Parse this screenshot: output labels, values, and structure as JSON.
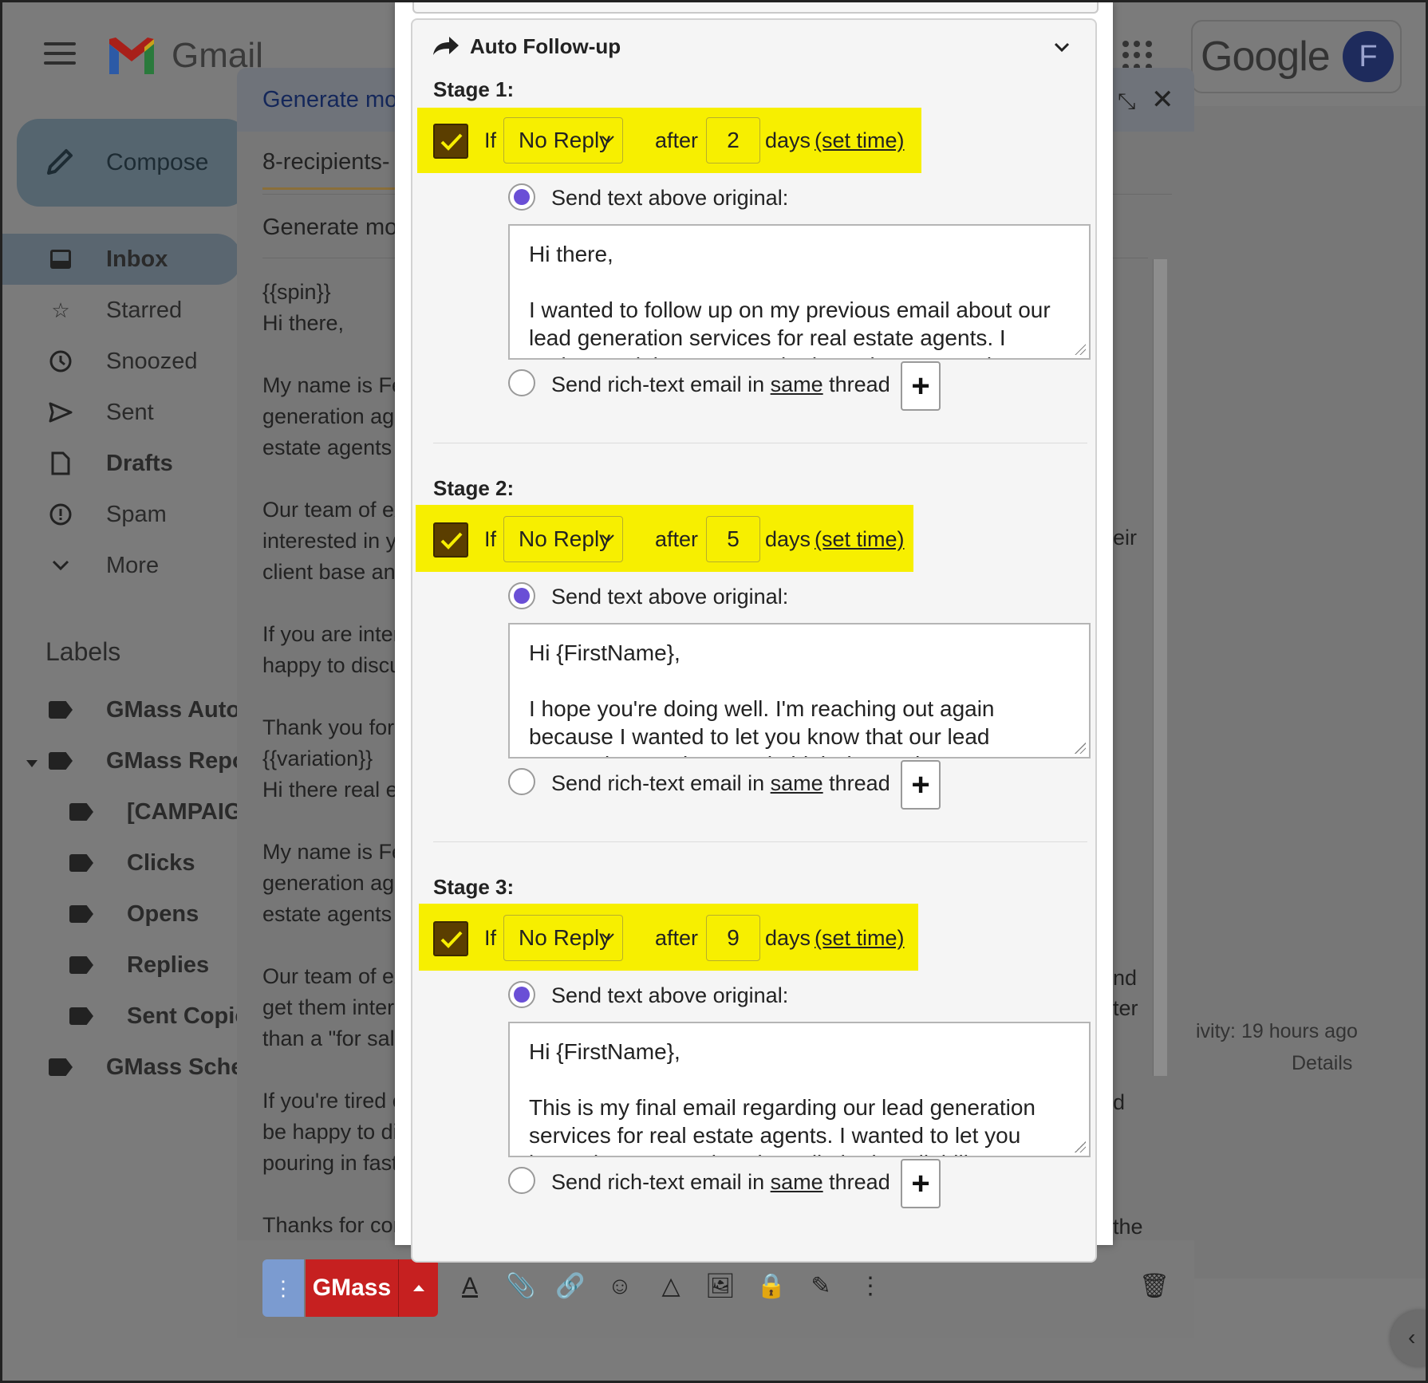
{
  "gmail": {
    "logo_text": "Gmail",
    "google_text": "Google",
    "avatar_letter": "F",
    "compose_label": "Compose",
    "nav": [
      {
        "label": "Inbox",
        "icon": "inbox-icon",
        "bold": true
      },
      {
        "label": "Starred",
        "icon": "star-icon"
      },
      {
        "label": "Snoozed",
        "icon": "clock-icon"
      },
      {
        "label": "Sent",
        "icon": "send-icon"
      },
      {
        "label": "Drafts",
        "icon": "draft-icon",
        "bold": true
      },
      {
        "label": "Spam",
        "icon": "spam-icon"
      },
      {
        "label": "More",
        "icon": "chevron-down-icon"
      }
    ],
    "labels_heading": "Labels",
    "labels": [
      "GMass Auto",
      "GMass Repo",
      "[CAMPAIG",
      "Clicks",
      "Opens",
      "Replies",
      "Sent Copie",
      "GMass Sche"
    ],
    "activity": "ivity: 19 hours ago",
    "details": "Details"
  },
  "compose": {
    "title": "Generate mo",
    "subject": "8-recipients-",
    "from_line": "Generate mo",
    "body_left": "{{spin}}\nHi there,\n\nMy name is Fe\ngeneration age\nestate agents\n\nOur team of ex\ninterested in yo\nclient base and\n\nIf you are inter\nhappy to discu\n\nThank you for\n{{variation}}\nHi there real e\n\nMy name is Fe\ngeneration age\nestate agents\n\nOur team of ex\nget them intere\nthan a \"for sale\n\nIf you're tired c\nbe happy to di\npouring in fast\n\nThanks for cor",
    "body_right": [
      "eir",
      "nd",
      "ter",
      "d",
      "the"
    ],
    "gmass_label": "GMass",
    "menu_dots": "⋮"
  },
  "followup": {
    "title": "Auto Follow-up",
    "if_label": "If",
    "after_label": "after",
    "days_label": "days",
    "set_time_label": "(set time)",
    "send_above_label": "Send text above original:",
    "rich_prefix": "Send rich-text email in ",
    "rich_link": "same",
    "rich_suffix": " thread",
    "stages": [
      {
        "label": "Stage 1:",
        "condition": "No Reply",
        "days": "2",
        "checked": true,
        "text": "Hi there,\n\nI wanted to follow up on my previous email about our lead generation services for real estate agents. I understand that you may be busy, but I wanted to"
      },
      {
        "label": "Stage 2:",
        "condition": "No Reply",
        "days": "5",
        "checked": true,
        "text": "Hi {FirstName},\n\nI hope you're doing well. I'm reaching out again because I wanted to let you know that our lead generation services are in high demand"
      },
      {
        "label": "Stage 3:",
        "condition": "No Reply",
        "days": "9",
        "checked": true,
        "text": "Hi {FirstName},\n\nThis is my final email regarding our lead generation services for real estate agents. I wanted to let you know that our services have limited availability"
      }
    ]
  },
  "colors": {
    "highlight": "#f7ef00",
    "gmass_red": "#c62020",
    "radio_on": "#6a4fd6",
    "checkbox": "#5b3e00"
  }
}
